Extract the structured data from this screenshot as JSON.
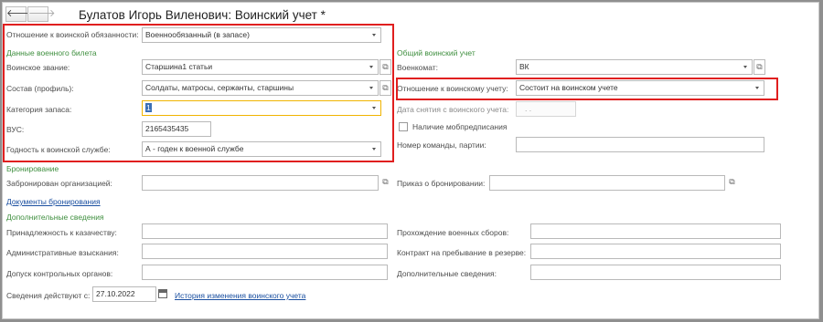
{
  "title": "Булатов Игорь Виленович: Воинский учет *",
  "nav": {
    "back": "🡐",
    "forward": "🡒"
  },
  "left": {
    "relation_label": "Отношение к воинской обязанности:",
    "relation_value": "Военнообязанный (в запасе)",
    "ticket_section": "Данные военного билета",
    "rank_label": "Воинское звание:",
    "rank_value": "Старшина1 статьи",
    "profile_label": "Состав (профиль):",
    "profile_value": "Солдаты, матросы, сержанты, старшины",
    "reserve_label": "Категория запаса:",
    "reserve_value": "1",
    "vus_label": "ВУС:",
    "vus_value": "2165435435",
    "fitness_label": "Годность к воинской службе:",
    "fitness_value": "А - годен к военной службе"
  },
  "right": {
    "section": "Общий воинский учет",
    "commissariat_label": "Военкомат:",
    "commissariat_value": "ВК",
    "registration_label": "Отношение к воинскому учету:",
    "registration_value": "Состоит на воинском учете",
    "removal_label": "Дата снятия с воинского учета:",
    "removal_value": ". .",
    "mob_label": "Наличие мобпредписания",
    "team_label": "Номер команды, партии:",
    "team_value": ""
  },
  "booking": {
    "section": "Бронирование",
    "org_label": "Забронирован организацией:",
    "org_value": "",
    "order_label": "Приказ о бронировании:",
    "order_value": "",
    "docs_link": "Документы бронирования"
  },
  "additional": {
    "section": "Дополнительные сведения",
    "cossack_label": "Принадлежность к казачеству:",
    "cossack_value": "",
    "penalty_label": "Административные взыскания:",
    "penalty_value": "",
    "access_label": "Допуск контрольных органов:",
    "access_value": "",
    "training_label": "Прохождение военных сборов:",
    "training_value": "",
    "contract_label": "Контракт на пребывание в резерве:",
    "contract_value": "",
    "extra_label": "Дополнительные сведения:",
    "extra_value": ""
  },
  "footer": {
    "valid_label": "Сведения действуют с:",
    "valid_value": "27.10.2022",
    "history_link": "История изменения воинского учета"
  },
  "icons": {
    "open": "⧉",
    "dropdown": "chevron-down-icon"
  },
  "colors": {
    "highlight": "#e01f1f",
    "section": "#3f8f3f",
    "link": "#1a4fa0",
    "warn": "#f0b400"
  }
}
